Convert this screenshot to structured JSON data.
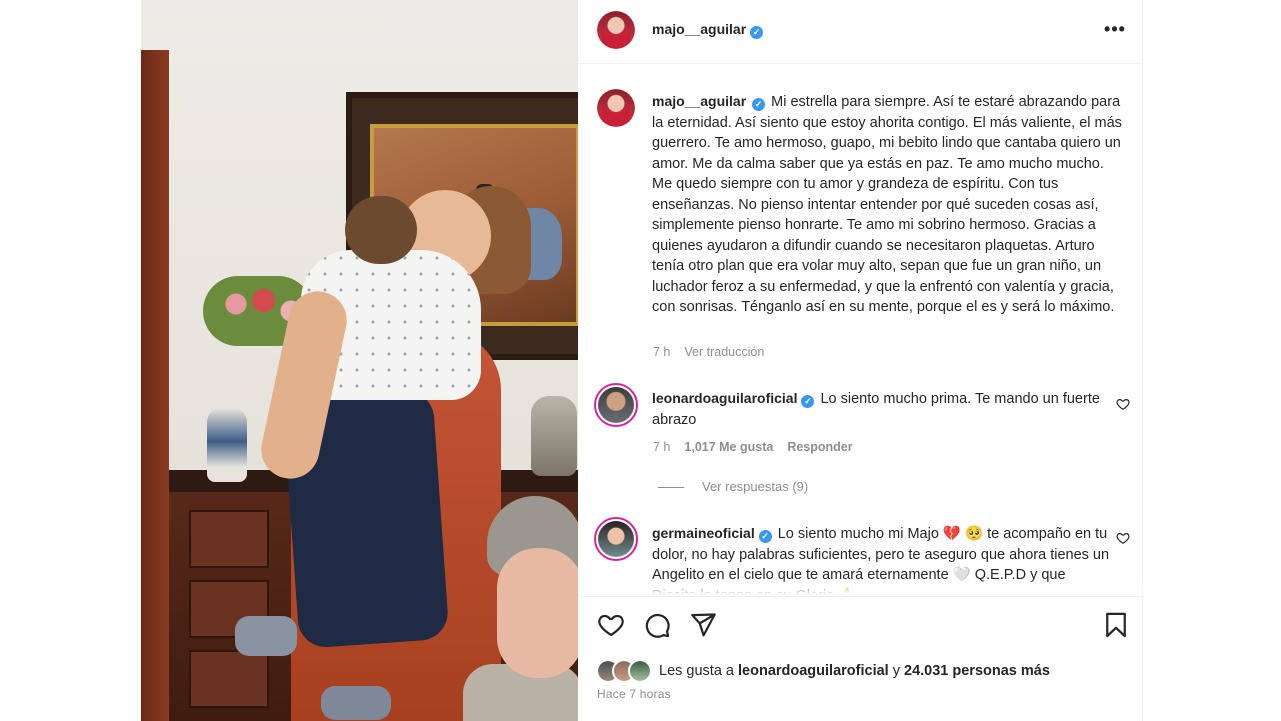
{
  "post": {
    "author": "majo__aguilar",
    "more_label": "•••"
  },
  "caption": {
    "username": "majo__aguilar",
    "text": "Mi estrella para siempre. Así te estaré abrazando para la eternidad. Así siento que estoy ahorita contigo. El más valiente, el más guerrero. Te amo hermoso, guapo, mi bebito lindo que cantaba quiero un amor. Me da calma saber que ya estás en paz. Te amo mucho mucho. Me quedo siempre con tu amor y grandeza de espíritu. Con tus enseñanzas. No pienso intentar entender por qué suceden cosas así, simplemente pienso honrarte. Te amo mi sobrino hermoso. Gracias a quienes ayudaron a difundir cuando se necesitaron plaquetas. Arturo tenía otro plan que era volar muy alto, sepan que fue un gran niño, un luchador feroz a su enfermedad, y que la enfrentó con valentía y gracia, con sonrisas. Ténganlo así en su mente, porque el es y será lo máximo.",
    "time": "7 h",
    "translate_label": "Ver traducción"
  },
  "comments": [
    {
      "username": "leonardoaguilaroficial",
      "text": "Lo siento mucho prima. Te mando un fuerte abrazo",
      "time": "7 h",
      "likes": "1,017 Me gusta",
      "reply_label": "Responder",
      "view_replies": "Ver respuestas (9)"
    },
    {
      "username": "germaineoficial",
      "text_before": "Lo siento mucho mi Majo",
      "emoji_heart": "💔",
      "emoji_sad": "🥺",
      "text_after": "te acompaño en tu dolor, no hay palabras suficientes, pero te aseguro que ahora tienes un Angelito en el cielo que te amará eternamente 🤍 Q.E.P.D y que Diosito lo tenga en su Gloria 🙏"
    }
  ],
  "likes": {
    "prefix": "Les gusta a",
    "user": "leonardoaguilaroficial",
    "middle": "y",
    "count": "24.031 personas más"
  },
  "posted_ago": "Hace 7 horas",
  "icons": {
    "more": "more-options-icon",
    "like": "heart-icon",
    "comment": "comment-icon",
    "share": "share-icon",
    "save": "bookmark-icon",
    "verified": "verified-badge-icon"
  },
  "colors": {
    "verified": "#3897f0",
    "muted": "#8e8e8e",
    "text": "#262626",
    "story_ring": "#d6249f"
  }
}
